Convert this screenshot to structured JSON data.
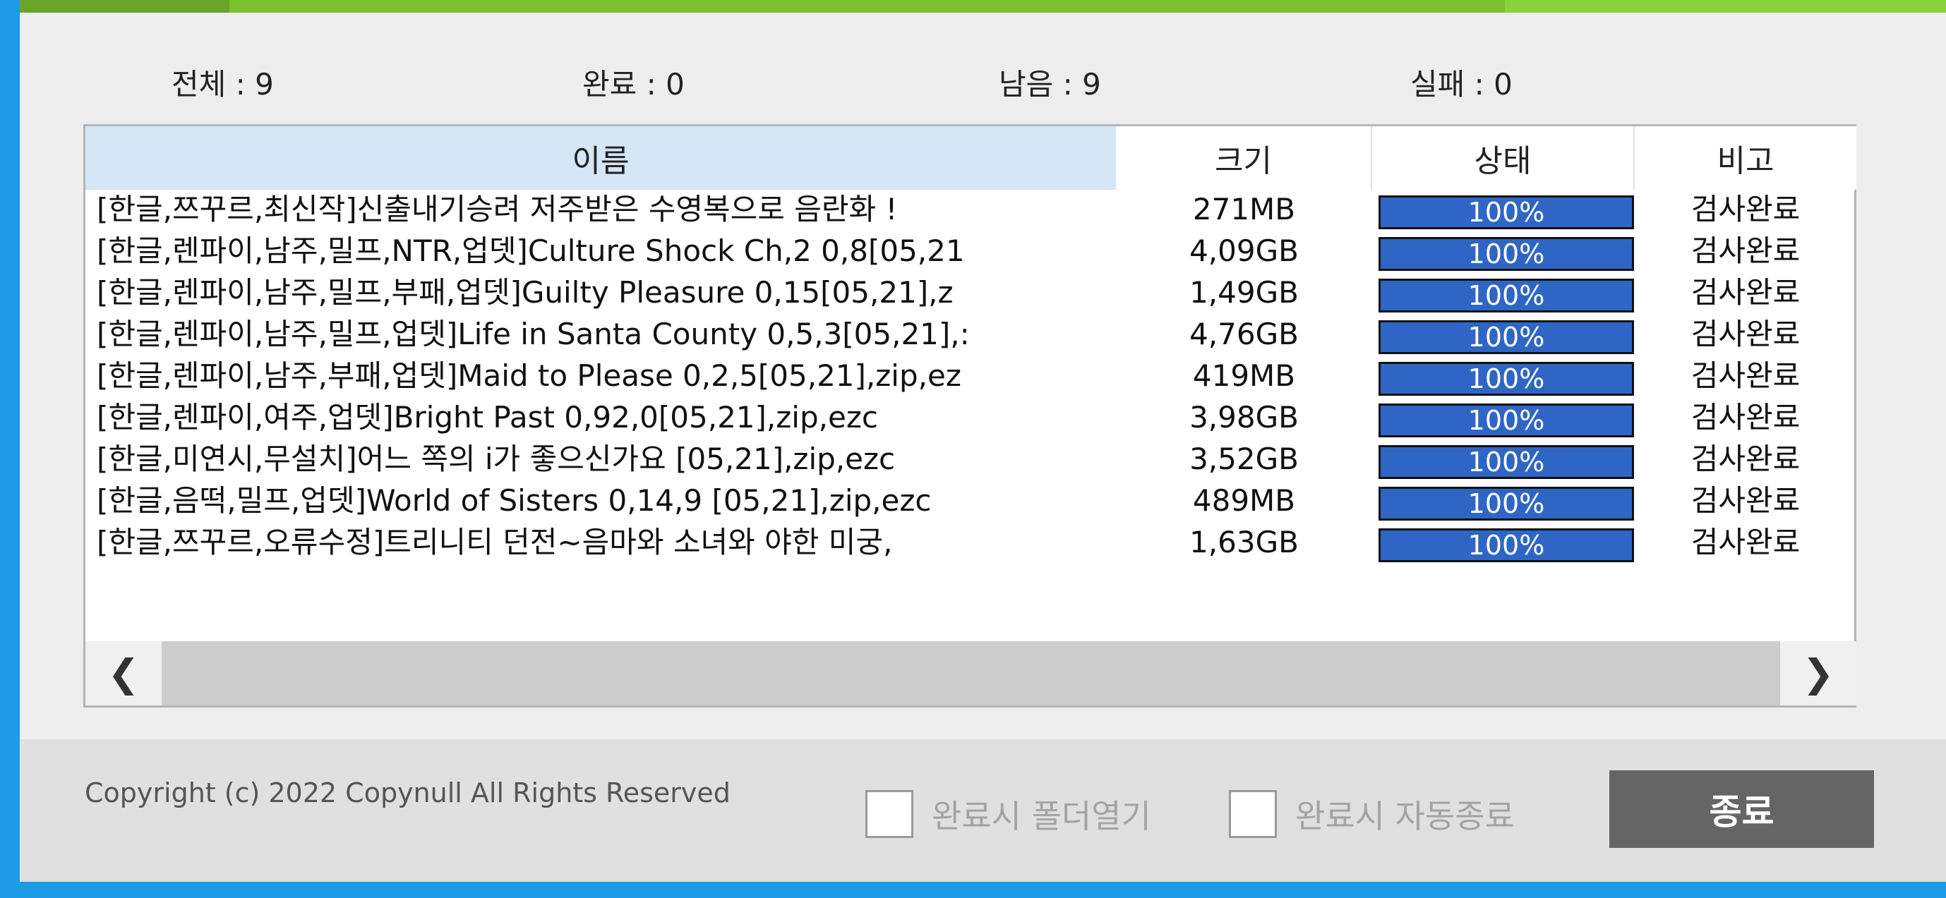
{
  "progress": {
    "fraction": 0.66,
    "colors": {
      "bar": "#7cc230"
    }
  },
  "stats": {
    "total": "전체 : 9",
    "done": "완료 : 0",
    "remaining": "남음 : 9",
    "failed": "실패 : 0"
  },
  "table": {
    "headers": {
      "name": "이름",
      "size": "크기",
      "status": "상태",
      "note": "비고"
    },
    "rows": [
      {
        "name": "[한글,쯔꾸르,최신작]신출내기승려 저주받은 수영복으로 음란화 !",
        "size": "271MB",
        "status": "100%",
        "note": "검사완료"
      },
      {
        "name": "[한글,렌파이,남주,밀프,NTR,업뎃]Culture Shock Ch,2 0,8[05,21",
        "size": "4,09GB",
        "status": "100%",
        "note": "검사완료"
      },
      {
        "name": "[한글,렌파이,남주,밀프,부패,업뎃]Guilty Pleasure 0,15[05,21],z",
        "size": "1,49GB",
        "status": "100%",
        "note": "검사완료"
      },
      {
        "name": "[한글,렌파이,남주,밀프,업뎃]Life in Santa County 0,5,3[05,21],:",
        "size": "4,76GB",
        "status": "100%",
        "note": "검사완료"
      },
      {
        "name": "[한글,렌파이,남주,부패,업뎃]Maid to Please 0,2,5[05,21],zip,ez",
        "size": "419MB",
        "status": "100%",
        "note": "검사완료"
      },
      {
        "name": "[한글,렌파이,여주,업뎃]Bright Past 0,92,0[05,21],zip,ezc",
        "size": "3,98GB",
        "status": "100%",
        "note": "검사완료"
      },
      {
        "name": "[한글,미연시,무설치]어느 쪽의 i가 좋으신가요 [05,21],zip,ezc",
        "size": "3,52GB",
        "status": "100%",
        "note": "검사완료"
      },
      {
        "name": "[한글,음떡,밀프,업뎃]World of Sisters 0,14,9 [05,21],zip,ezc",
        "size": "489MB",
        "status": "100%",
        "note": "검사완료"
      },
      {
        "name": "[한글,쯔꾸르,오류수정]트리니티 던전~음마와 소녀와 야한 미궁,",
        "size": "1,63GB",
        "status": "100%",
        "note": "검사완료"
      }
    ]
  },
  "scrollbar": {
    "left_icon": "chevron-left-icon",
    "right_icon": "chevron-right-icon"
  },
  "footer": {
    "copyright": "Copyright (c) 2022 Copynull All Rights Reserved",
    "open_folder_label": "완료시 폴더열기",
    "auto_exit_label": "완료시 자동종료",
    "exit_label": "종료"
  }
}
